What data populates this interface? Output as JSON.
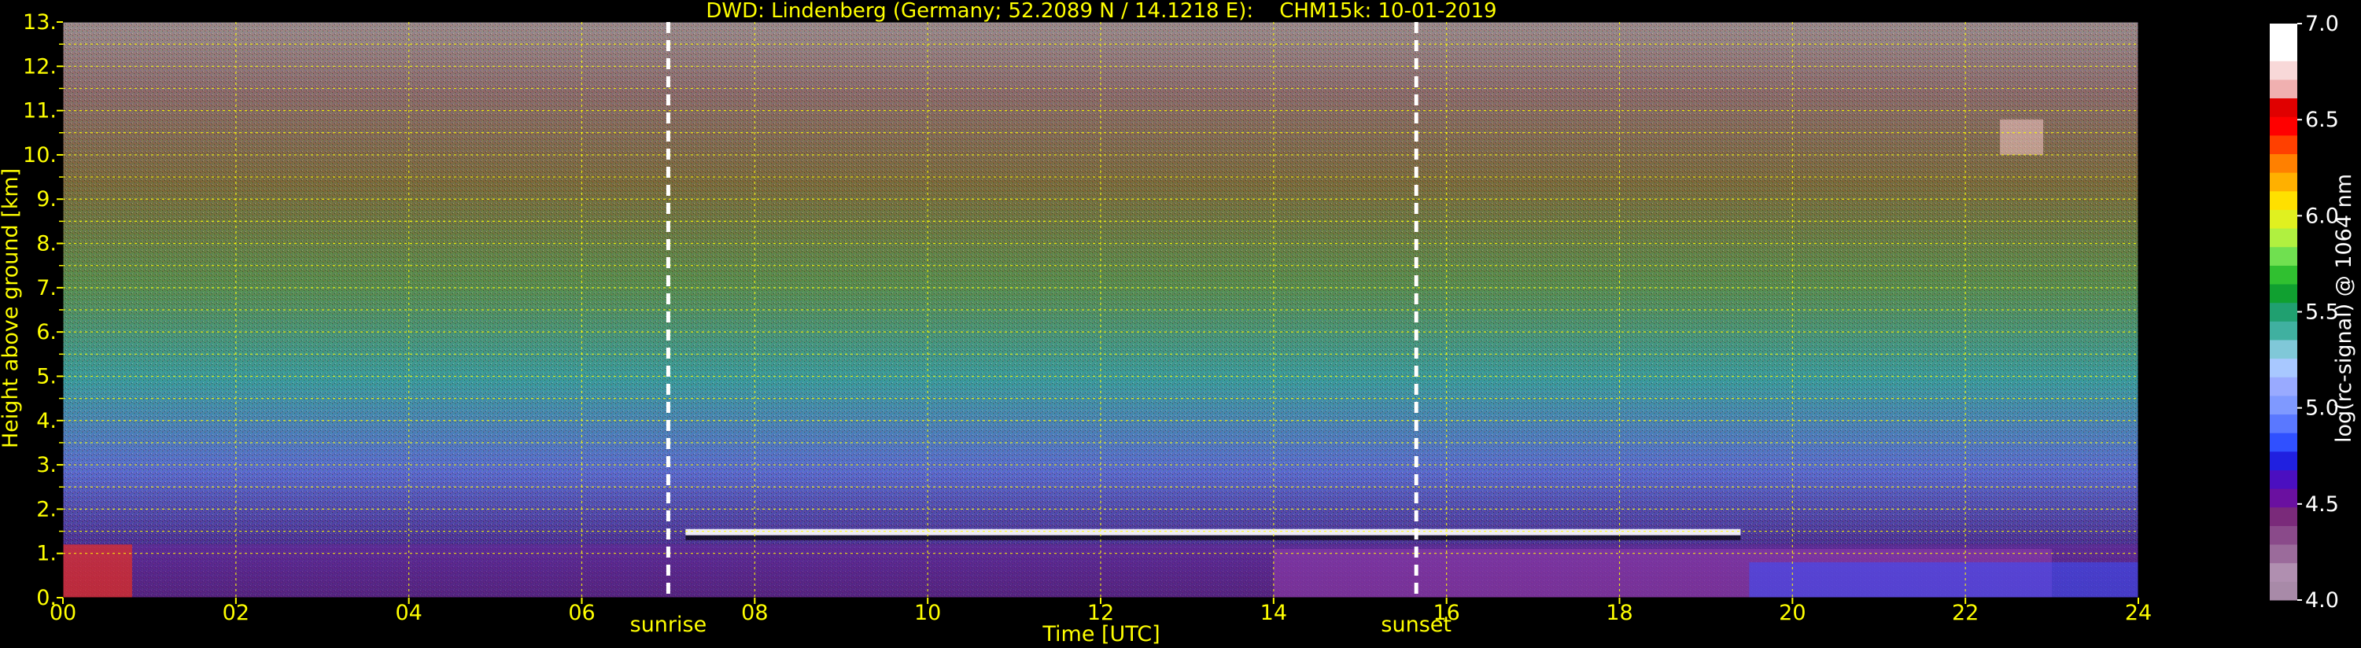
{
  "chart_data": {
    "type": "heatmap",
    "title": "DWD: Lindenberg (Germany; 52.2089 N / 14.1218 E):    CHM15k: 10-01-2019",
    "xlabel": "Time [UTC]",
    "ylabel": "Height above ground [km]",
    "xlim": [
      0,
      24
    ],
    "ylim": [
      0,
      13
    ],
    "x_ticks": [
      "00",
      "02",
      "04",
      "06",
      "08",
      "10",
      "12",
      "14",
      "16",
      "18",
      "20",
      "22",
      "24"
    ],
    "y_ticks": [
      "0.0",
      "1.0",
      "1.5",
      "2.0",
      "2.5",
      "3.0",
      "3.5",
      "4.0",
      "4.5",
      "5.0",
      "5.5",
      "6.0",
      "6.5",
      "7.0",
      "7.5",
      "8.0",
      "8.5",
      "9.0",
      "9.5",
      "10.0",
      "10.5",
      "11.0",
      "11.5",
      "12.0",
      "12.5",
      "13.0"
    ],
    "y_tick_values": [
      0,
      1,
      1.5,
      2,
      2.5,
      3,
      3.5,
      4,
      4.5,
      5,
      5.5,
      6,
      6.5,
      7,
      7.5,
      8,
      8.5,
      9,
      9.5,
      10,
      10.5,
      11,
      11.5,
      12,
      12.5,
      13
    ],
    "y_tick_labels_shown": [
      "0.",
      "1.",
      "2.",
      "3.",
      "4.",
      "5.",
      "6.",
      "7.",
      "8.",
      "9.",
      "10.",
      "11.",
      "12.",
      "13."
    ],
    "grid": true,
    "markers": [
      {
        "label": "sunrise",
        "x": 7.0
      },
      {
        "label": "sunset",
        "x": 15.65
      }
    ],
    "colorbar": {
      "label": "log(rc-signal) @ 1064 nm",
      "min": 4.0,
      "max": 7.0,
      "ticks": [
        "4.0",
        "4.5",
        "5.0",
        "5.5",
        "6.0",
        "6.5",
        "7.0"
      ],
      "colors": [
        "#a88aa8",
        "#b08fb0",
        "#9b6b9b",
        "#8a4a8a",
        "#7a2a7a",
        "#6a10a0",
        "#4b0fc0",
        "#2020e0",
        "#3050ff",
        "#5a78ff",
        "#7f99ff",
        "#99aaff",
        "#a8c8ff",
        "#80c8d8",
        "#40b0a0",
        "#20a070",
        "#10a030",
        "#30c030",
        "#70e050",
        "#b0f040",
        "#e0f020",
        "#ffe000",
        "#ffb000",
        "#ff8000",
        "#ff4000",
        "#ff0000",
        "#e00000",
        "#f0b0b0",
        "#f8d8d8",
        "#ffffff",
        "#ffffff"
      ]
    }
  }
}
